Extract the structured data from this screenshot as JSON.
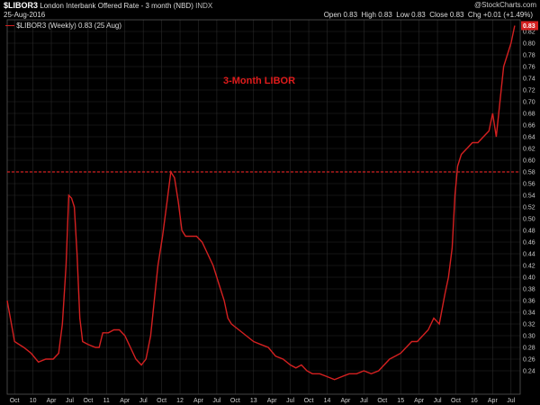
{
  "header": {
    "symbol": "$LIBOR3",
    "description": "London Interbank Offered Rate - 3 month (NBD)",
    "exchange": "INDX",
    "date": "25-Aug-2016",
    "open_label": "Open",
    "open": "0.83",
    "high_label": "High",
    "high": "0.83",
    "low_label": "Low",
    "low": "0.83",
    "close_label": "Close",
    "close": "0.83",
    "chg_label": "Chg",
    "chg": "+0.01 (+1.49%)",
    "brand": "@StockCharts.com"
  },
  "legend": {
    "text": "$LIBOR3 (Weekly) 0.83 (25 Aug)"
  },
  "colors": {
    "line": "#d42020",
    "bg": "#000000",
    "grid": "#2a2a2a",
    "text": "#cccccc",
    "last_box": "#d42020"
  },
  "chart_data": {
    "type": "line",
    "title": "",
    "annotation": "3-Month LIBOR",
    "last_value_label": "0.83",
    "xlabel": "",
    "ylabel": "",
    "ylim": [
      0.2,
      0.84
    ],
    "xlim": [
      0,
      32
    ],
    "y_ticks": [
      0.24,
      0.26,
      0.28,
      0.3,
      0.32,
      0.34,
      0.36,
      0.38,
      0.4,
      0.42,
      0.44,
      0.46,
      0.48,
      0.5,
      0.52,
      0.54,
      0.56,
      0.58,
      0.6,
      0.62,
      0.64,
      0.66,
      0.68,
      0.7,
      0.72,
      0.74,
      0.76,
      0.78,
      0.8,
      0.82
    ],
    "x_ticks": [
      {
        "pos": 0.4,
        "label": "Oct"
      },
      {
        "pos": 1.4,
        "label": "10"
      },
      {
        "pos": 2.4,
        "label": "Apr"
      },
      {
        "pos": 3.4,
        "label": "Jul"
      },
      {
        "pos": 4.4,
        "label": "Oct"
      },
      {
        "pos": 5.4,
        "label": "11"
      },
      {
        "pos": 6.4,
        "label": "Apr"
      },
      {
        "pos": 7.4,
        "label": "Jul"
      },
      {
        "pos": 8.4,
        "label": "Oct"
      },
      {
        "pos": 9.4,
        "label": "12"
      },
      {
        "pos": 10.4,
        "label": "Apr"
      },
      {
        "pos": 11.4,
        "label": "Jul"
      },
      {
        "pos": 12.4,
        "label": "Oct"
      },
      {
        "pos": 13.4,
        "label": "13"
      },
      {
        "pos": 14.4,
        "label": "Apr"
      },
      {
        "pos": 15.4,
        "label": "Jul"
      },
      {
        "pos": 16.4,
        "label": "Oct"
      },
      {
        "pos": 17.4,
        "label": "14"
      },
      {
        "pos": 18.4,
        "label": "Apr"
      },
      {
        "pos": 19.4,
        "label": "Jul"
      },
      {
        "pos": 20.4,
        "label": "Oct"
      },
      {
        "pos": 21.4,
        "label": "15"
      },
      {
        "pos": 22.4,
        "label": "Apr"
      },
      {
        "pos": 23.4,
        "label": "Jul"
      },
      {
        "pos": 24.4,
        "label": "Oct"
      },
      {
        "pos": 25.4,
        "label": "16"
      },
      {
        "pos": 26.4,
        "label": "Apr"
      },
      {
        "pos": 27.4,
        "label": "Jul"
      }
    ],
    "reference_line": 0.58,
    "series": [
      {
        "points": [
          [
            0.0,
            0.36
          ],
          [
            0.4,
            0.29
          ],
          [
            0.9,
            0.28
          ],
          [
            1.3,
            0.27
          ],
          [
            1.7,
            0.255
          ],
          [
            2.1,
            0.26
          ],
          [
            2.5,
            0.26
          ],
          [
            2.8,
            0.27
          ],
          [
            3.0,
            0.32
          ],
          [
            3.2,
            0.42
          ],
          [
            3.35,
            0.54
          ],
          [
            3.5,
            0.535
          ],
          [
            3.65,
            0.52
          ],
          [
            3.8,
            0.44
          ],
          [
            3.95,
            0.33
          ],
          [
            4.1,
            0.29
          ],
          [
            4.4,
            0.285
          ],
          [
            4.8,
            0.28
          ],
          [
            5.0,
            0.28
          ],
          [
            5.2,
            0.305
          ],
          [
            5.5,
            0.305
          ],
          [
            5.8,
            0.31
          ],
          [
            6.1,
            0.31
          ],
          [
            6.4,
            0.3
          ],
          [
            6.7,
            0.28
          ],
          [
            7.0,
            0.26
          ],
          [
            7.3,
            0.25
          ],
          [
            7.55,
            0.26
          ],
          [
            7.8,
            0.3
          ],
          [
            8.0,
            0.36
          ],
          [
            8.2,
            0.42
          ],
          [
            8.45,
            0.47
          ],
          [
            8.7,
            0.53
          ],
          [
            8.9,
            0.58
          ],
          [
            9.1,
            0.57
          ],
          [
            9.3,
            0.53
          ],
          [
            9.5,
            0.48
          ],
          [
            9.7,
            0.47
          ],
          [
            10.0,
            0.47
          ],
          [
            10.3,
            0.47
          ],
          [
            10.6,
            0.46
          ],
          [
            10.9,
            0.44
          ],
          [
            11.2,
            0.42
          ],
          [
            11.5,
            0.39
          ],
          [
            11.8,
            0.36
          ],
          [
            12.0,
            0.33
          ],
          [
            12.2,
            0.32
          ],
          [
            12.6,
            0.31
          ],
          [
            13.0,
            0.3
          ],
          [
            13.4,
            0.29
          ],
          [
            13.8,
            0.285
          ],
          [
            14.2,
            0.28
          ],
          [
            14.6,
            0.265
          ],
          [
            15.0,
            0.26
          ],
          [
            15.4,
            0.25
          ],
          [
            15.7,
            0.245
          ],
          [
            16.0,
            0.25
          ],
          [
            16.3,
            0.24
          ],
          [
            16.6,
            0.235
          ],
          [
            17.0,
            0.235
          ],
          [
            17.4,
            0.23
          ],
          [
            17.8,
            0.225
          ],
          [
            18.2,
            0.23
          ],
          [
            18.6,
            0.235
          ],
          [
            19.0,
            0.235
          ],
          [
            19.4,
            0.24
          ],
          [
            19.8,
            0.235
          ],
          [
            20.2,
            0.24
          ],
          [
            20.5,
            0.25
          ],
          [
            20.8,
            0.26
          ],
          [
            21.1,
            0.265
          ],
          [
            21.4,
            0.27
          ],
          [
            21.7,
            0.28
          ],
          [
            22.0,
            0.29
          ],
          [
            22.3,
            0.29
          ],
          [
            22.6,
            0.3
          ],
          [
            22.9,
            0.31
          ],
          [
            23.2,
            0.33
          ],
          [
            23.5,
            0.32
          ],
          [
            23.8,
            0.37
          ],
          [
            24.0,
            0.4
          ],
          [
            24.2,
            0.45
          ],
          [
            24.35,
            0.54
          ],
          [
            24.5,
            0.59
          ],
          [
            24.7,
            0.61
          ],
          [
            25.0,
            0.62
          ],
          [
            25.3,
            0.63
          ],
          [
            25.6,
            0.63
          ],
          [
            25.9,
            0.64
          ],
          [
            26.2,
            0.65
          ],
          [
            26.4,
            0.68
          ],
          [
            26.6,
            0.64
          ],
          [
            26.8,
            0.7
          ],
          [
            27.0,
            0.76
          ],
          [
            27.2,
            0.78
          ],
          [
            27.4,
            0.8
          ],
          [
            27.6,
            0.83
          ]
        ]
      }
    ]
  }
}
